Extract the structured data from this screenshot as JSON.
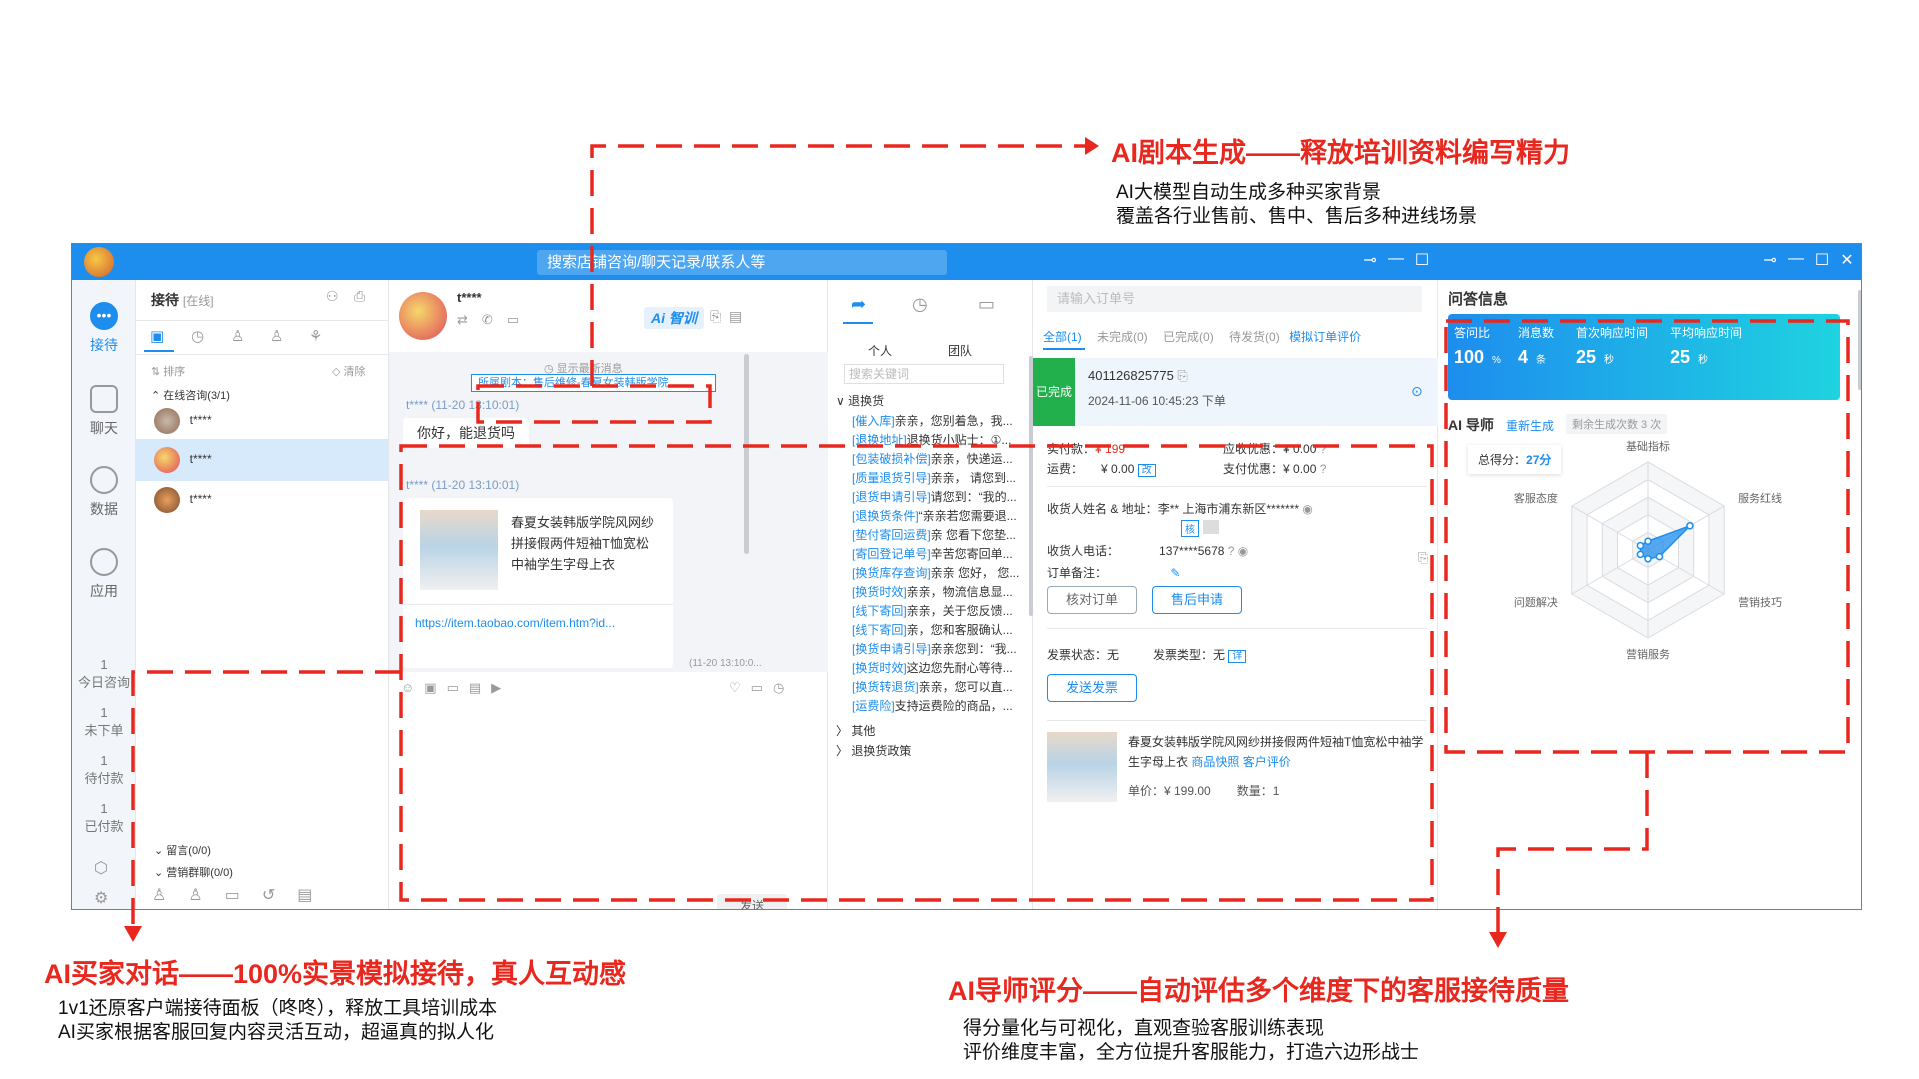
{
  "annotations": {
    "script_title": "AI剧本生成——释放培训资料编写精力",
    "script_desc": [
      "AI大模型自动生成多种买家背景",
      "覆盖各行业售前、售中、售后多种进线场景"
    ],
    "buyer_title": "AI买家对话——100%实景模拟接待，真人互动感",
    "buyer_desc": [
      "1v1还原客户端接待面板（咚咚），释放工具培训成本",
      "AI买家根据客服回复内容灵活互动，超逼真的拟人化"
    ],
    "mentor_title": "AI导师评分——自动评估多个维度下的客服接待质量",
    "mentor_desc": [
      "得分量化与可视化，直观查验客服训练表现",
      "评价维度丰富，全方位提升客服能力，打造六边形战士"
    ]
  },
  "titlebar": {
    "search_placeholder": "搜索店铺咨询/聊天记录/联系人等"
  },
  "leftnav": {
    "items": [
      "接待",
      "聊天",
      "数据",
      "应用"
    ],
    "stats": [
      {
        "value": "1",
        "label": "今日咨询"
      },
      {
        "value": "1",
        "label": "未下单"
      },
      {
        "value": "1",
        "label": "待付款"
      },
      {
        "value": "1",
        "label": "已付款"
      }
    ]
  },
  "panel2": {
    "title": "接待",
    "status": "[在线]",
    "sort": "排序",
    "clear": "清除",
    "group": "在线咨询(3/1)",
    "users": [
      "t****",
      "t****",
      "t****"
    ],
    "msg": "留言(0/0)",
    "marketing": "营销群聊(0/0)"
  },
  "chat": {
    "name": "t****",
    "ai_train": "Ai 智训",
    "latest": "显示最新消息",
    "script_tag": "所属剧本：售后维修-春夏女装韩版学院...",
    "msg1_head": "t****  (11-20 13:10:01)",
    "msg1": "你好，能退货吗",
    "msg2_head": "t****  (11-20 13:10:01)",
    "product_title": "春夏女装韩版学院风网纱拼接假两件短袖T恤宽松中袖学生字母上衣",
    "product_link": "https://item.taobao.com/item.htm?id...",
    "time_bottom": "(11-20 13:10:0...",
    "send": "发送"
  },
  "quick": {
    "tab_personal": "个人",
    "tab_team": "团队",
    "search_placeholder": "搜索关键词",
    "group": "退换货",
    "items": [
      {
        "tag": "[催入库]",
        "text": "亲亲，您别着急，我..."
      },
      {
        "tag": "[退换地址]",
        "text": "退换货小贴士：①..."
      },
      {
        "tag": "[包装破损补偿]",
        "text": "亲亲，快递运..."
      },
      {
        "tag": "[质量退货引导]",
        "text": "亲亲， 请您到..."
      },
      {
        "tag": "[退货申请引导]",
        "text": "请您到：“我的..."
      },
      {
        "tag": "[退换货条件]",
        "text": "“亲亲若您需要退..."
      },
      {
        "tag": "[垫付寄回运费]",
        "text": "亲 您看下您垫..."
      },
      {
        "tag": "[寄回登记单号]",
        "text": "辛苦您寄回单..."
      },
      {
        "tag": "[换货库存查询]",
        "text": "亲亲 您好， 您..."
      },
      {
        "tag": "[换货时效]",
        "text": "亲亲，物流信息显..."
      },
      {
        "tag": "[线下寄回]",
        "text": "亲亲，关于您反馈..."
      },
      {
        "tag": "[线下寄回]",
        "text": "亲，您和客服确认..."
      },
      {
        "tag": "[换货申请引导]",
        "text": "亲亲您到：“我..."
      },
      {
        "tag": "[换货时效]",
        "text": "这边您先耐心等待..."
      },
      {
        "tag": "[换货转退货]",
        "text": "亲亲，您可以直..."
      },
      {
        "tag": "[运费险]",
        "text": "支持运费险的商品，..."
      }
    ],
    "other": "其他",
    "policy": "退换货政策"
  },
  "order": {
    "search_placeholder": "请输入订单号",
    "tabs": [
      "全部(1)",
      "未完成(0)",
      "已完成(0)",
      "待发货(0)",
      "模拟订单评价"
    ],
    "status": "已完成",
    "order_no": "401126825775",
    "order_time": "2024-11-06 10:45:23  下单",
    "paid_label": "实付款：",
    "paid_value": "¥ 199",
    "shipping_label": "运费：",
    "shipping_value": "¥ 0.00",
    "shipping_btn": "改",
    "receivable_label": "应收优惠：",
    "receivable_value": "¥ 0.00",
    "pay_discount_label": "支付优惠：",
    "pay_discount_value": "¥ 0.00",
    "receiver_label": "收货人姓名 & 地址：",
    "receiver_value": "李** 上海市浦东新区*******",
    "verify_tag": "核",
    "phone_label": "收货人电话：",
    "phone_value": "137****5678",
    "remark_label": "订单备注：",
    "btn_check": "核对订单",
    "btn_aftersale": "售后申请",
    "invoice_status": "发票状态：无",
    "invoice_type": "发票类型：无",
    "invoice_detail": "详",
    "btn_invoice": "发送发票",
    "product_title": "春夏女装韩版学院风网纱拼接假两件短袖T恤宽松中袖学生字母上衣",
    "snapshot": "商品快照",
    "review": "客户评价",
    "unit_price": "单价：¥ 199.00",
    "qty": "数量：1"
  },
  "qa": {
    "title": "问答信息",
    "metrics": [
      {
        "label": "答问比",
        "value": "100",
        "unit": "%"
      },
      {
        "label": "消息数",
        "value": "4",
        "unit": "条"
      },
      {
        "label": "首次响应时间",
        "value": "25",
        "unit": "秒"
      },
      {
        "label": "平均响应时间",
        "value": "25",
        "unit": "秒"
      }
    ],
    "mentor_title": "AI 导师",
    "regen": "重新生成",
    "remain": "剩余生成次数 3 次",
    "score_label": "总得分：",
    "score_value": "27分",
    "radar_labels": [
      "基础指标",
      "服务红线",
      "营销技巧",
      "营销服务",
      "问题解决",
      "客服态度"
    ]
  },
  "chart_data": {
    "type": "radar",
    "categories": [
      "基础指标",
      "服务红线",
      "营销技巧",
      "营销服务",
      "问题解决",
      "客服态度"
    ],
    "values": [
      0.1,
      0.55,
      0.15,
      0.1,
      0.1,
      0.1
    ],
    "ylim": [
      0,
      1
    ],
    "grid": true
  },
  "colors": {
    "accent": "#1d8dee",
    "annotation": "#e8281e",
    "metric_bg_start": "#1d8dee",
    "metric_bg_end": "#1fd3e0"
  }
}
